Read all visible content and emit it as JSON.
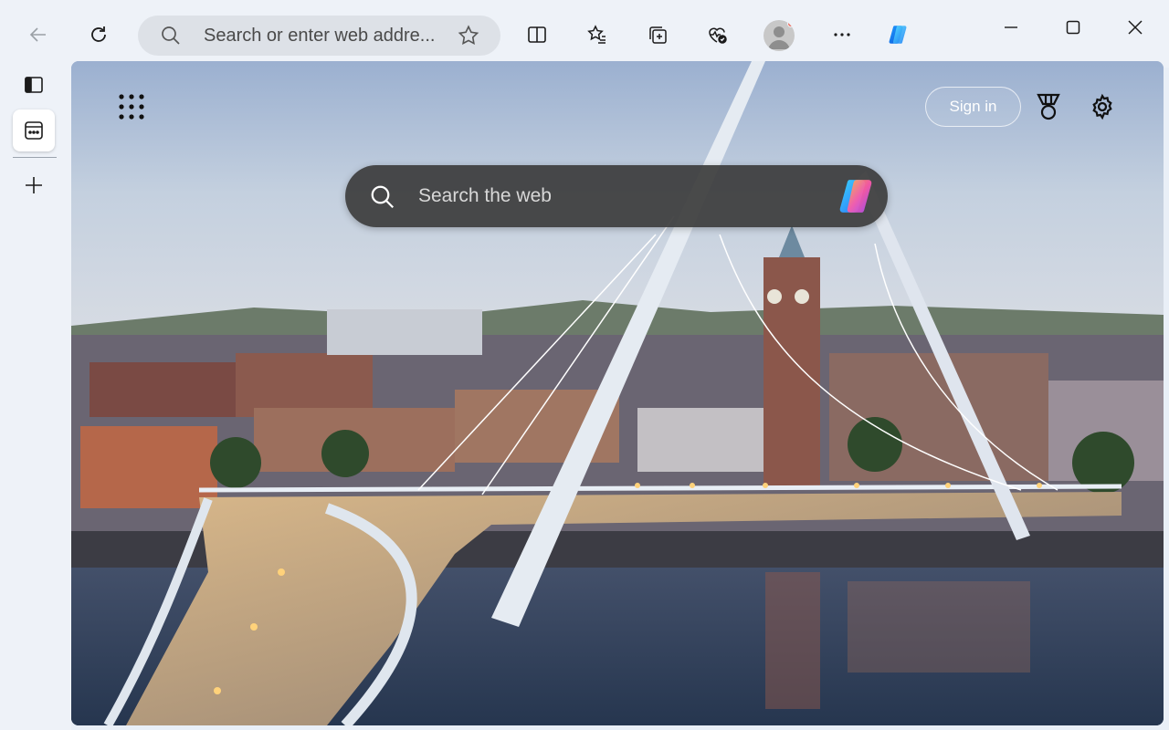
{
  "toolbar": {
    "address_placeholder": "Search or enter web addre...",
    "icons": [
      "back-arrow-icon",
      "refresh-icon",
      "search-icon",
      "favorite-star-icon",
      "split-screen-icon",
      "favorites-icon",
      "collections-icon",
      "browser-essentials-icon",
      "profile-avatar-icon",
      "more-icon",
      "copilot-icon"
    ]
  },
  "window_controls": [
    "minimize-icon",
    "maximize-icon",
    "close-icon"
  ],
  "sidebar": {
    "items": [
      "tab-actions-icon",
      "workspaces-icon",
      "new-tab-plus-icon"
    ]
  },
  "new_tab_page": {
    "sign_in_label": "Sign in",
    "search_placeholder": "Search the web",
    "icons": [
      "apps-grid-icon",
      "rewards-icon",
      "settings-gear-icon",
      "copilot-icon"
    ]
  },
  "colors": {
    "chrome_bg": "#eef2f8",
    "address_bg": "#dde1e7",
    "search_box_bg": "#3c3c3c"
  }
}
